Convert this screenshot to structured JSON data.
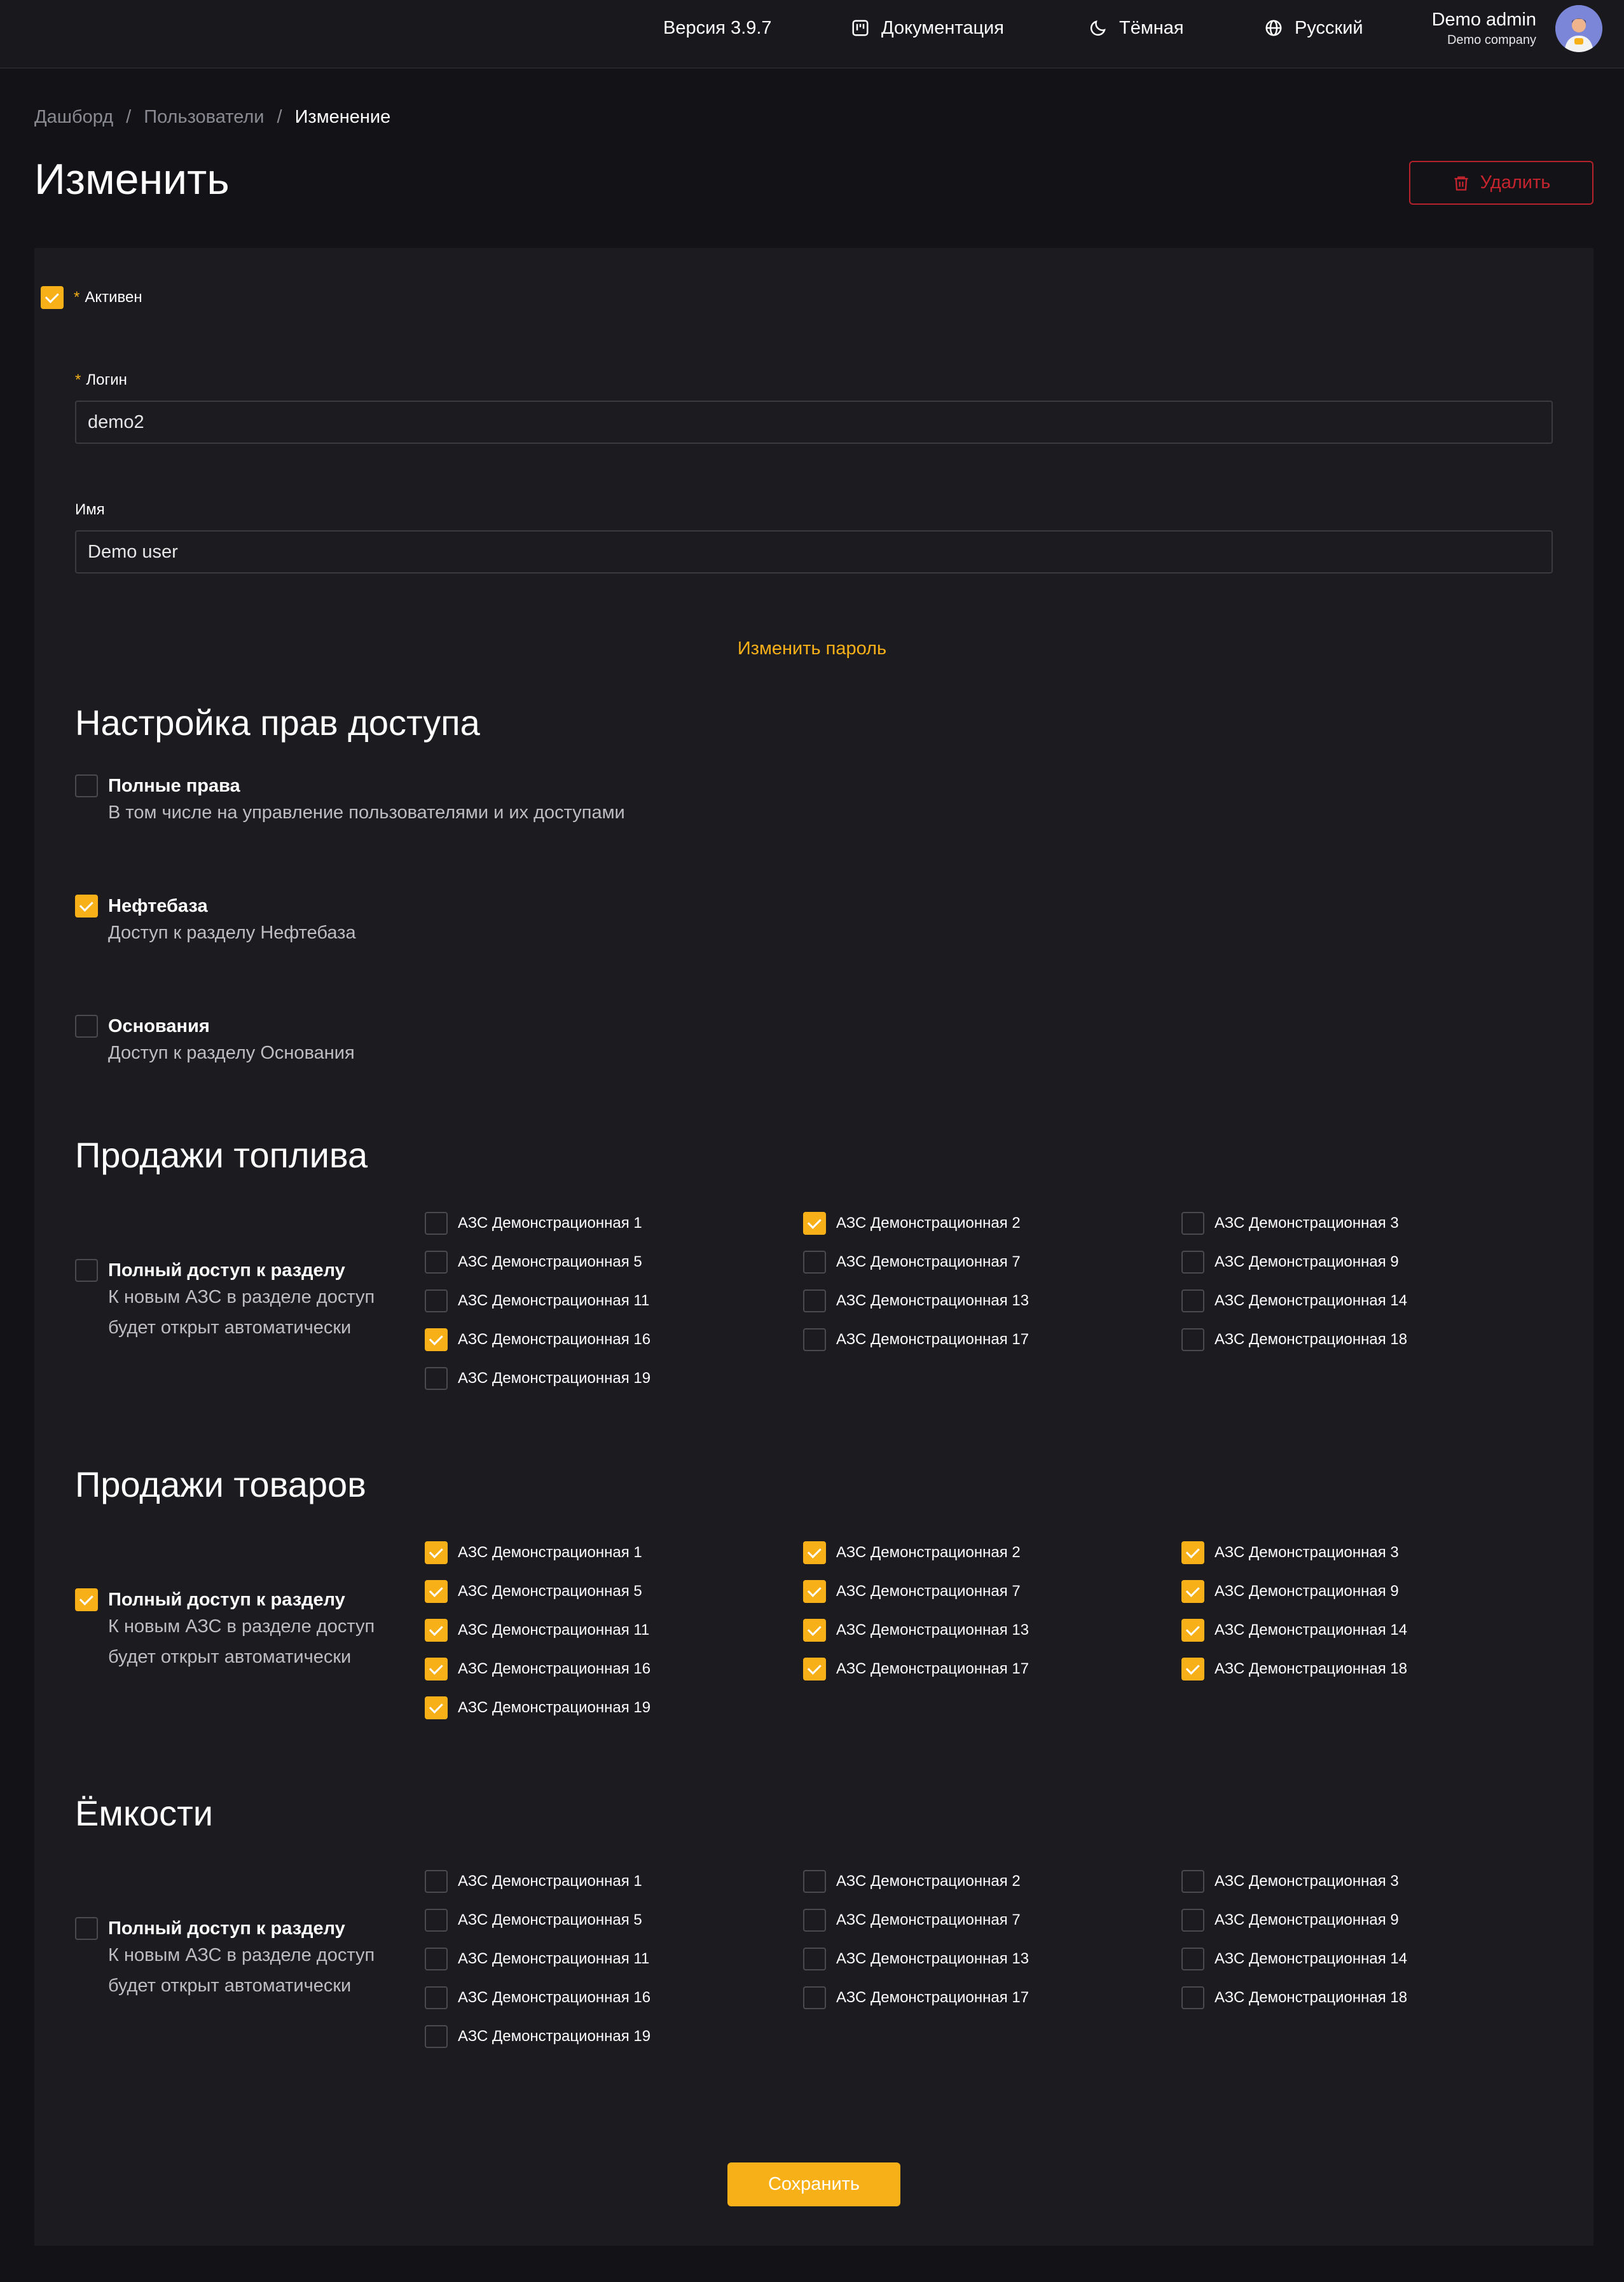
{
  "header": {
    "version": "Версия 3.9.7",
    "docs": "Документация",
    "theme": "Тёмная",
    "language": "Русский",
    "user_name": "Demo admin",
    "user_company": "Demo company"
  },
  "breadcrumb": {
    "items": [
      "Дашборд",
      "Пользователи",
      "Изменение"
    ],
    "separator": "/"
  },
  "page": {
    "title": "Изменить",
    "delete_label": "Удалить",
    "save_label": "Сохранить",
    "change_password": "Изменить пароль"
  },
  "form": {
    "active": {
      "label": "Активен",
      "required_mark": "*",
      "checked": true
    },
    "login": {
      "label": "Логин",
      "required_mark": "*",
      "value": "demo2"
    },
    "name": {
      "label": "Имя",
      "value": "Demo user"
    }
  },
  "access_settings": {
    "title": "Настройка прав доступа",
    "items": [
      {
        "title": "Полные права",
        "desc": "В том числе на управление пользователями и их доступами",
        "checked": false
      },
      {
        "title": "Нефтебаза",
        "desc": "Доступ к разделу Нефтебаза",
        "checked": true
      },
      {
        "title": "Основания",
        "desc": "Доступ к разделу Основания",
        "checked": false
      }
    ]
  },
  "full_access_text": {
    "title": "Полный доступ к разделу",
    "desc": "К новым АЗС в разделе доступ будет открыт автоматически"
  },
  "stations": [
    "АЗС Демонстрационная 1",
    "АЗС Демонстрационная 2",
    "АЗС Демонстрационная 3",
    "АЗС Демонстрационная 5",
    "АЗС Демонстрационная 7",
    "АЗС Демонстрационная 9",
    "АЗС Демонстрационная 11",
    "АЗС Демонстрационная 13",
    "АЗС Демонстрационная 14",
    "АЗС Демонстрационная 16",
    "АЗС Демонстрационная 17",
    "АЗС Демонстрационная 18",
    "АЗС Демонстрационная 19"
  ],
  "sections": [
    {
      "title": "Продажи топлива",
      "full_access": false,
      "checked": [
        false,
        true,
        false,
        false,
        false,
        false,
        false,
        false,
        false,
        true,
        false,
        false,
        false
      ]
    },
    {
      "title": "Продажи товаров",
      "full_access": true,
      "checked": [
        true,
        true,
        true,
        true,
        true,
        true,
        true,
        true,
        true,
        true,
        true,
        true,
        true
      ]
    },
    {
      "title": "Ёмкости",
      "full_access": false,
      "checked": [
        false,
        false,
        false,
        false,
        false,
        false,
        false,
        false,
        false,
        false,
        false,
        false,
        false
      ]
    }
  ],
  "colors": {
    "accent": "#f7b018",
    "danger": "#c4242e",
    "background": "#121217",
    "card": "#1b1b20"
  },
  "icons": {
    "docs": "kanban-board-icon",
    "theme": "moon-icon",
    "language": "globe-icon",
    "delete": "trash-icon",
    "avatar": "user-avatar"
  }
}
